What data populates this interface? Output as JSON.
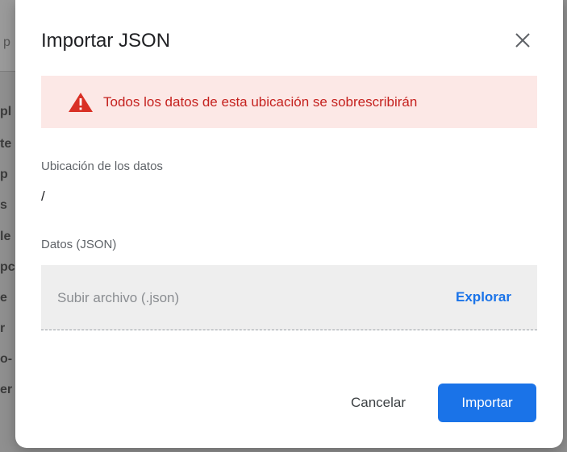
{
  "background": {
    "fragments": [
      "p",
      "pl",
      "te",
      "p",
      "s",
      "le",
      "pc",
      "e",
      "r",
      "o-",
      "er"
    ]
  },
  "dialog": {
    "title": "Importar JSON",
    "close_icon": "close-icon",
    "alert": {
      "icon": "warning-icon",
      "text": "Todos los datos de esta ubicación se sobrescribirán",
      "color": "#c5221f",
      "background": "#fce8e6"
    },
    "location": {
      "label": "Ubicación de los datos",
      "value": "/"
    },
    "data_field": {
      "label": "Datos (JSON)",
      "placeholder": "Subir archivo (.json)",
      "browse_label": "Explorar"
    },
    "actions": {
      "cancel_label": "Cancelar",
      "import_label": "Importar",
      "accent": "#1a73e8"
    }
  }
}
